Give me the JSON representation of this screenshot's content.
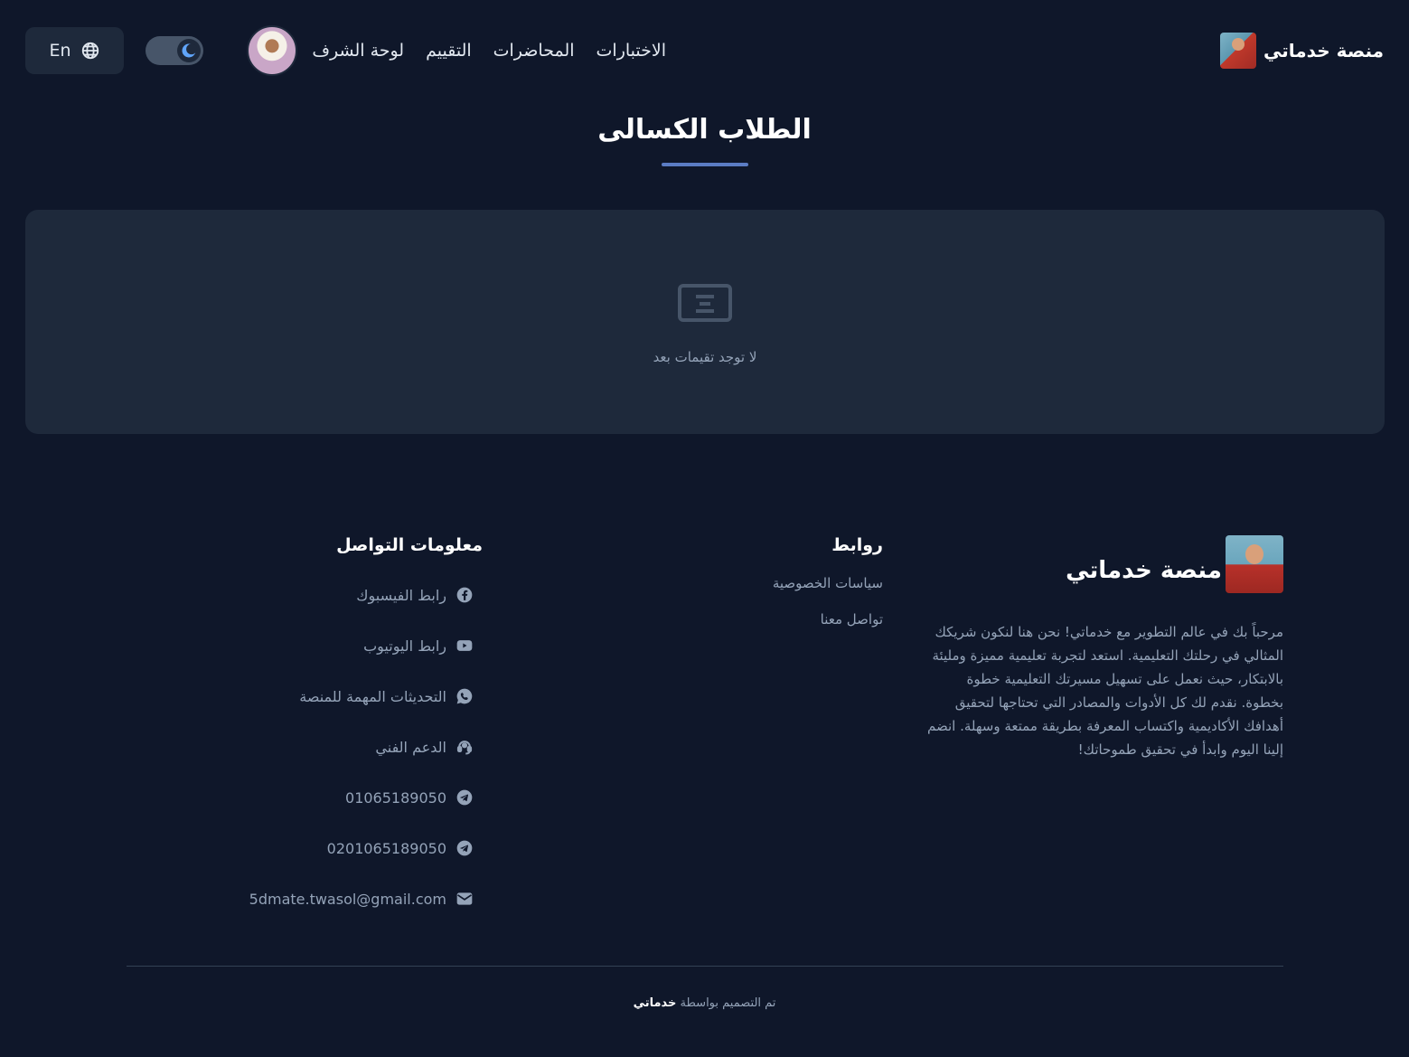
{
  "brand": {
    "name": "منصة خدماتي"
  },
  "nav": {
    "items": [
      "الاختبارات",
      "المحاضرات",
      "التقييم",
      "لوحة الشرف"
    ]
  },
  "header": {
    "language_label": "En"
  },
  "page": {
    "title": "الطلاب الكسالى"
  },
  "empty_state": {
    "message": "لا توجد تقيمات بعد"
  },
  "footer": {
    "brand_name": "منصة خدماتي",
    "description": "مرحباً بك في عالم التطوير مع خدماتي! نحن هنا لنكون شريكك المثالي في رحلتك التعليمية. استعد لتجربة تعليمية مميزة ومليئة بالابتكار، حيث نعمل على تسهيل مسيرتك التعليمية خطوة بخطوة. نقدم لك كل الأدوات والمصادر التي تحتاجها لتحقيق أهدافك الأكاديمية واكتساب المعرفة بطريقة ممتعة وسهلة. انضم إلينا اليوم وابدأ في تحقيق طموحاتك!",
    "links_title": "روابط",
    "links": [
      "سياسات الخصوصية",
      "تواصل معنا"
    ],
    "contact_title": "معلومات التواصل",
    "contacts": [
      {
        "icon": "facebook-icon",
        "label": "رابط الفيسبوك"
      },
      {
        "icon": "youtube-icon",
        "label": "رابط اليوتيوب"
      },
      {
        "icon": "whatsapp-icon",
        "label": "التحديثات المهمة للمنصة"
      },
      {
        "icon": "support-icon",
        "label": "الدعم الفني"
      },
      {
        "icon": "telegram-icon",
        "label": "01065189050"
      },
      {
        "icon": "telegram-icon",
        "label": "0201065189050"
      },
      {
        "icon": "mail-icon",
        "label": "5dmate.twasol@gmail.com"
      }
    ],
    "credit_prefix": "تم التصميم بواسطة",
    "credit_name": "خدماتي"
  },
  "colors": {
    "background": "#0f172a",
    "card": "#1e293b",
    "accent": "#5b7cc4",
    "muted_text": "#94a3b8"
  }
}
